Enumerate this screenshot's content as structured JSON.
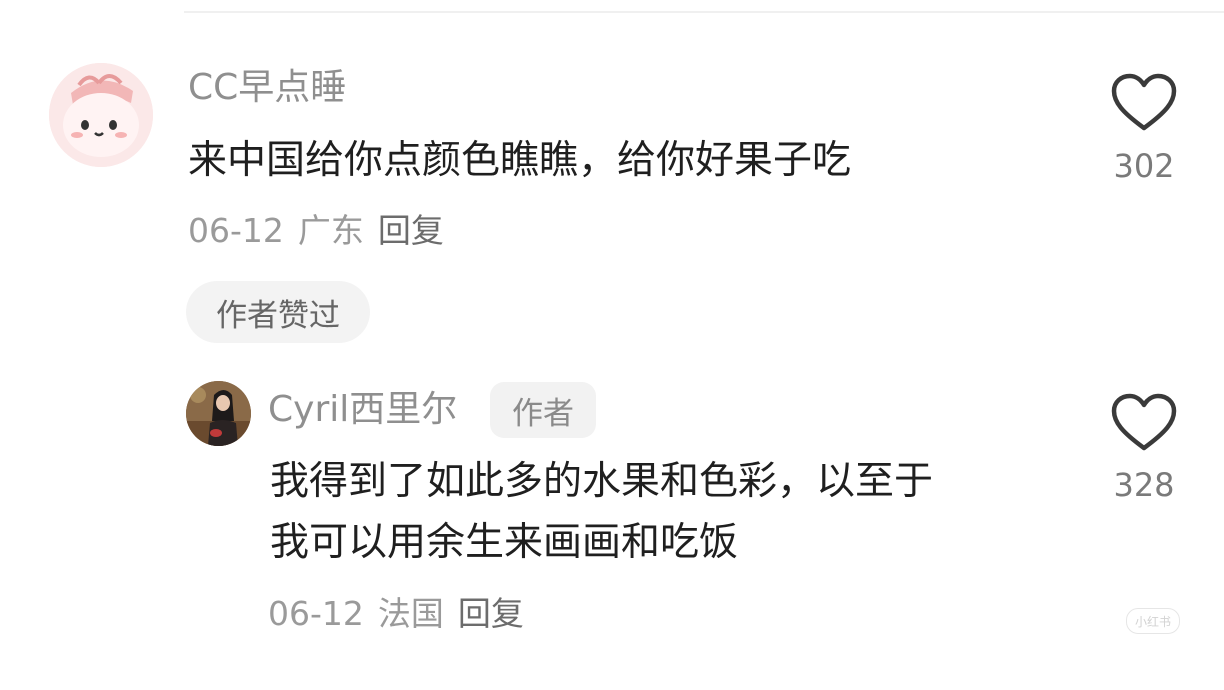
{
  "comment": {
    "username": "CC早点睡",
    "content": "来中国给你点颜色瞧瞧，给你好果子吃",
    "date": "06-12",
    "location": "广东",
    "reply_label": "回复",
    "author_liked_label": "作者赞过",
    "like_count": "302",
    "avatar_icon": "pink-blob-avatar"
  },
  "reply": {
    "username": "Cyril西里尔",
    "author_tag": "作者",
    "content_line1": "我得到了如此多的水果和色彩，以至于",
    "content_line2": "我可以用余生来画画和吃饭",
    "date": "06-12",
    "location": "法国",
    "reply_label": "回复",
    "like_count": "328",
    "avatar_icon": "person-photo-avatar"
  },
  "watermark": {
    "text": "小红书"
  },
  "colors": {
    "username": "#8f8f8f",
    "content": "#1f1f1f",
    "meta": "#9a9a9a",
    "badge_bg": "#f3f3f3"
  }
}
